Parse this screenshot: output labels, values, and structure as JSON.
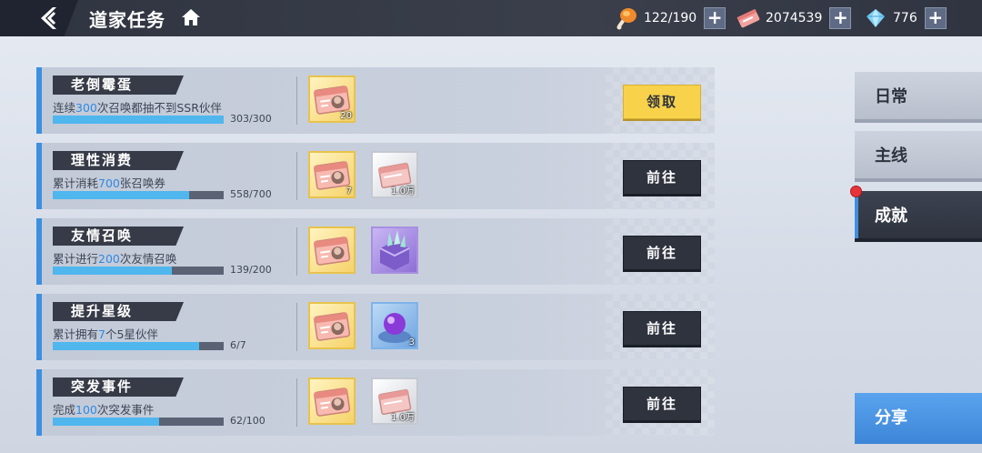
{
  "header": {
    "title": "道家任务",
    "resources": [
      {
        "icon": "drumstick-icon",
        "value": "122/190"
      },
      {
        "icon": "ticket-icon",
        "value": "2074539"
      },
      {
        "icon": "diamond-icon",
        "value": "776"
      }
    ]
  },
  "quests": [
    {
      "title": "老倒霉蛋",
      "desc_pre": "连续",
      "desc_num": "300",
      "desc_post": "次召唤都抽不到SSR伙伴",
      "progress": "303/300",
      "fraction": 1.0,
      "rewards": [
        {
          "type": "summon-ticket",
          "count": "20"
        }
      ],
      "action": "领取",
      "claimable": true
    },
    {
      "title": "理性消费",
      "desc_pre": "累计消耗",
      "desc_num": "700",
      "desc_post": "张召唤券",
      "progress": "558/700",
      "fraction": 0.797,
      "rewards": [
        {
          "type": "summon-ticket",
          "count": "7"
        },
        {
          "type": "silver-box",
          "count": "1.0万"
        }
      ],
      "action": "前往",
      "claimable": false
    },
    {
      "title": "友情召唤",
      "desc_pre": "累计进行",
      "desc_num": "200",
      "desc_post": "次友情召唤",
      "progress": "139/200",
      "fraction": 0.695,
      "rewards": [
        {
          "type": "summon-ticket",
          "count": ""
        },
        {
          "type": "crystal-box",
          "count": ""
        }
      ],
      "action": "前往",
      "claimable": false
    },
    {
      "title": "提升星级",
      "desc_pre": "累计拥有",
      "desc_num": "7",
      "desc_post": "个5星伙伴",
      "progress": "6/7",
      "fraction": 0.857,
      "rewards": [
        {
          "type": "summon-ticket",
          "count": ""
        },
        {
          "type": "orb-cushion",
          "count": "3"
        }
      ],
      "action": "前往",
      "claimable": false
    },
    {
      "title": "突发事件",
      "desc_pre": "完成",
      "desc_num": "100",
      "desc_post": "次突发事件",
      "progress": "62/100",
      "fraction": 0.62,
      "rewards": [
        {
          "type": "summon-ticket",
          "count": ""
        },
        {
          "type": "silver-box",
          "count": "1.0万"
        }
      ],
      "action": "前往",
      "claimable": false
    }
  ],
  "tabs": {
    "daily": "日常",
    "main": "主线",
    "achievement": "成就",
    "share": "分享"
  },
  "colors": {
    "accent": "#3d8fe0",
    "highlight": "#2f8ae2",
    "claim": "#f7d24a",
    "notify": "#e8333a"
  }
}
